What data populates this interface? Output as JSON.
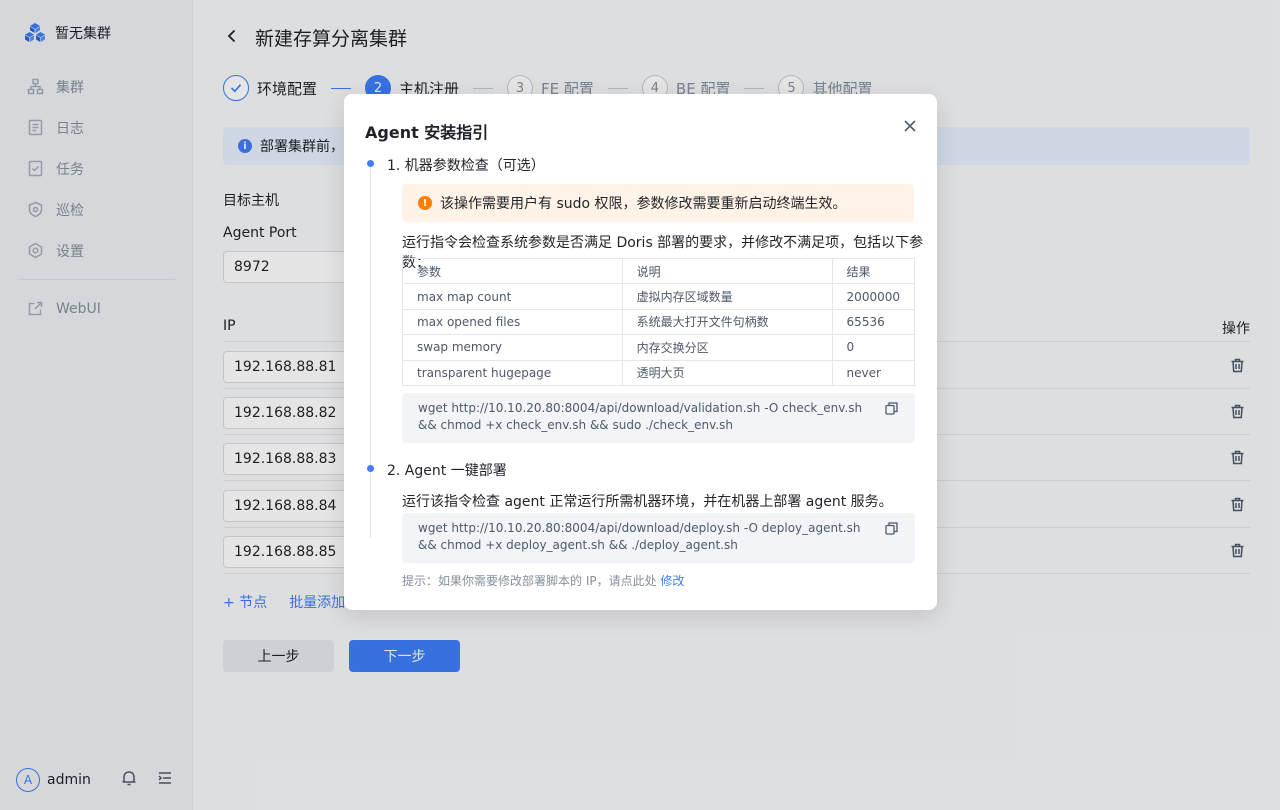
{
  "sidebar": {
    "cluster_name": "暂无集群",
    "items": [
      {
        "label": "集群",
        "icon": "cluster-icon"
      },
      {
        "label": "日志",
        "icon": "log-icon"
      },
      {
        "label": "任务",
        "icon": "task-icon"
      },
      {
        "label": "巡检",
        "icon": "inspect-icon"
      },
      {
        "label": "设置",
        "icon": "settings-icon"
      }
    ],
    "webui": "WebUI",
    "user": {
      "avatar": "A",
      "name": "admin"
    }
  },
  "page": {
    "title": "新建存算分离集群",
    "steps": [
      {
        "num": "1",
        "label": "环境配置",
        "state": "done"
      },
      {
        "num": "2",
        "label": "主机注册",
        "state": "active"
      },
      {
        "num": "3",
        "label": "FE 配置",
        "state": "pending"
      },
      {
        "num": "4",
        "label": "BE 配置",
        "state": "pending"
      },
      {
        "num": "5",
        "label": "其他配置",
        "state": "pending"
      }
    ],
    "info_text": "部署集群前，请",
    "target_host_label": "目标主机",
    "agent_port_label": "Agent Port",
    "agent_port_value": "8972",
    "ip_header": "IP",
    "op_header": "操作",
    "ips": [
      "192.168.88.81",
      "192.168.88.82",
      "192.168.88.83",
      "192.168.88.84",
      "192.168.88.85"
    ],
    "add_node": "+ 节点",
    "batch_add": "批量添加",
    "prev": "上一步",
    "next": "下一步"
  },
  "modal": {
    "title": "Agent 安装指引",
    "section1": "1. 机器参数检查（可选）",
    "warning": "该操作需要用户有 sudo 权限，参数修改需要重新启动终端生效。",
    "desc1": "运行指令会检查系统参数是否满足 Doris 部署的要求，并修改不满足项，包括以下参数：",
    "table": {
      "headers": [
        "参数",
        "说明",
        "结果"
      ],
      "rows": [
        [
          "max map count",
          "虚拟内存区域数量",
          "2000000"
        ],
        [
          "max opened files",
          "系统最大打开文件句柄数",
          "65536"
        ],
        [
          "swap memory",
          "内存交换分区",
          "0"
        ],
        [
          "transparent hugepage",
          "透明大页",
          "never"
        ]
      ]
    },
    "cmd1": "wget http://10.10.20.80:8004/api/download/validation.sh -O check_env.sh && chmod +x check_env.sh && sudo ./check_env.sh",
    "section2": "2. Agent 一键部署",
    "desc2": "运行该指令检查 agent 正常运行所需机器环境，并在机器上部署 agent 服务。",
    "cmd2": "wget http://10.10.20.80:8004/api/download/deploy.sh -O deploy_agent.sh && chmod +x deploy_agent.sh && ./deploy_agent.sh",
    "hint": "提示：如果你需要修改部署脚本的 IP，请点此处 ",
    "hint_link": "修改"
  },
  "colors": {
    "primary": "#3f7ef7",
    "warning": "#ff7d00"
  }
}
